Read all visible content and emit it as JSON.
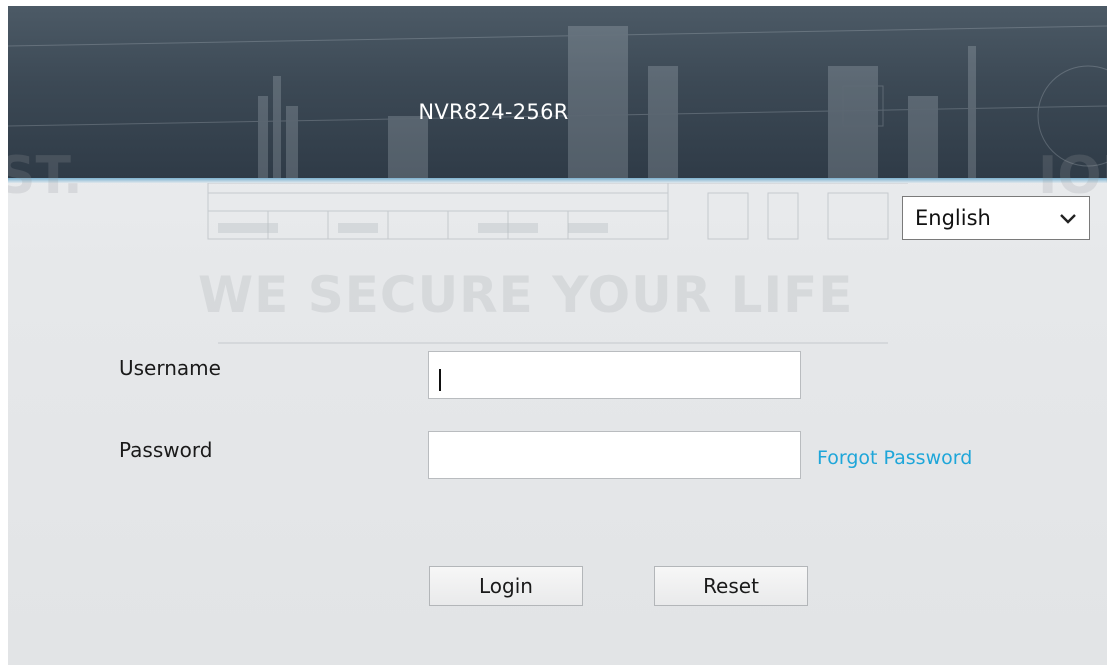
{
  "header": {
    "device_model": "NVR824-256R"
  },
  "language": {
    "selected": "English"
  },
  "background": {
    "slogan": "WE SECURE YOUR LIFE",
    "left_fragment": "ST.",
    "right_fragment": "IOU"
  },
  "form": {
    "username_label": "Username",
    "username_value": "",
    "password_label": "Password",
    "password_value": "",
    "forgot_password": "Forgot Password",
    "login_button": "Login",
    "reset_button": "Reset"
  },
  "colors": {
    "header_bg": "#3c4955",
    "link": "#1ea6d9",
    "panel_bg": "#e6e8ea"
  }
}
